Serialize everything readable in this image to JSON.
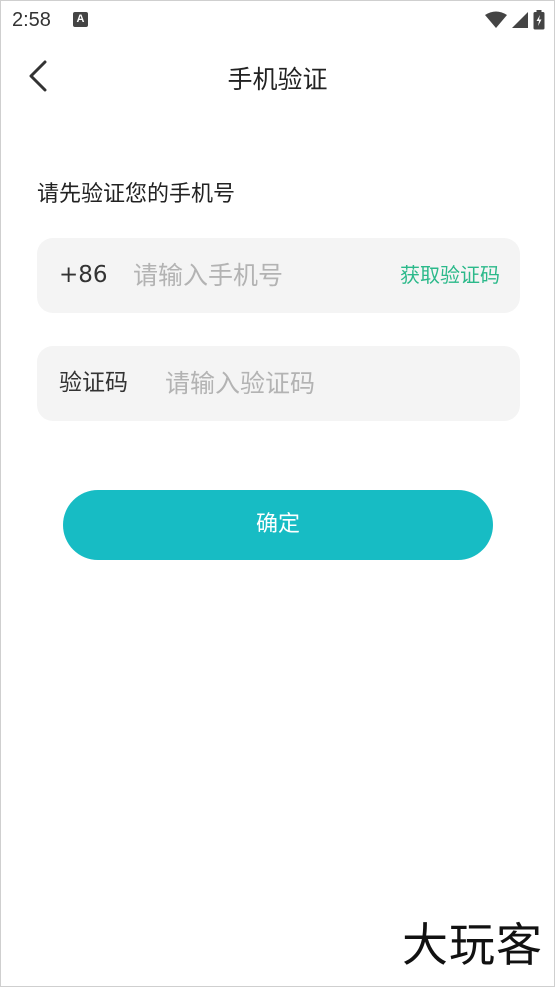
{
  "status_bar": {
    "time": "2:58",
    "a_icon": "A"
  },
  "header": {
    "title": "手机验证"
  },
  "main": {
    "subtitle": "请先验证您的手机号",
    "phone_field": {
      "prefix": "+86",
      "placeholder": "请输入手机号",
      "value": "",
      "get_code_label": "获取验证码"
    },
    "code_field": {
      "label": "验证码",
      "placeholder": "请输入验证码",
      "value": ""
    },
    "confirm_label": "确定"
  },
  "watermark": "大玩客",
  "colors": {
    "accent": "#17bcc4",
    "link": "#2bb98a",
    "field_bg": "#f4f4f4"
  }
}
